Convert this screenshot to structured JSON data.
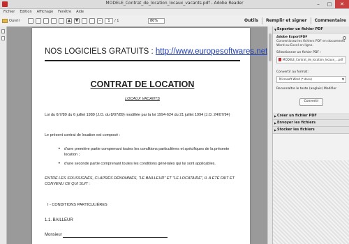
{
  "window": {
    "title": "MODELE_Contrat_de_location_locaux_vacants.pdf - Adobe Reader",
    "minimize": "–",
    "maximize": "□",
    "close": "✕"
  },
  "menu": [
    "Fichier",
    "Edition",
    "Affichage",
    "Fenêtre",
    "Aide"
  ],
  "toolbar": {
    "open_label": "Ouvrir",
    "page_number": "1",
    "page_count": "/ 1",
    "zoom": "80%",
    "tools": "Outils",
    "fill_sign": "Remplir et signer",
    "comment": "Commentaire"
  },
  "document": {
    "heading_prefix": "NOS LOGICIELS GRATUITS : ",
    "heading_link": "http://www.europesoftwares.net",
    "contract_title": "CONTRAT DE LOCATION",
    "subtitle": "LOCAUX VACANTS",
    "law_text": "Loi du 6/7/89 du 6 juillet 1989 (J.O. du 8/07/89) modifiée par la loi 1994-624 du 21 juillet 1994 (J.O. 24/07/94)",
    "intro": "Le présent contrat de location est composé :",
    "bullets": [
      "d'une première partie comprenant toutes les conditions particulières et spécifiques de la présente location ;",
      "d'une seconde partie comprenant toutes les conditions générales qui lui sont applicables."
    ],
    "between": "ENTRE LES SOUSSIGNÉS, CI-APRÈS DÉNOMMÉS, \"LE BAILLEUR\" ET \"LE LOCATAIRE\", IL A ÉTÉ FAIT ET CONVENU CE QUI SUIT :",
    "section": "I - CONDITIONS PARTICULIÈRES",
    "subsection": "1.1. BAILLEUR",
    "monsieur": "Monsieur"
  },
  "panel": {
    "export_title": "Exporter un fichier PDF",
    "adobe_name": "Adobe ExportPDF",
    "adobe_desc": "Convertissez les fichiers PDF en documents Word ou Excel en ligne.",
    "select_file_label": "Sélectionner un fichier PDF :",
    "file_name": "MODELE_Contrat_de_location_locaux_...pdf",
    "convert_to_label": "Convertir au format :",
    "convert_to_value": "Microsoft Word (*.docx)",
    "recognize": "Reconnaître le texte (anglais) Modifier",
    "convert_button": "Convertir",
    "create_title": "Créer un fichier PDF",
    "send_title": "Envoyer les fichiers",
    "store_title": "Stocker les fichiers"
  }
}
